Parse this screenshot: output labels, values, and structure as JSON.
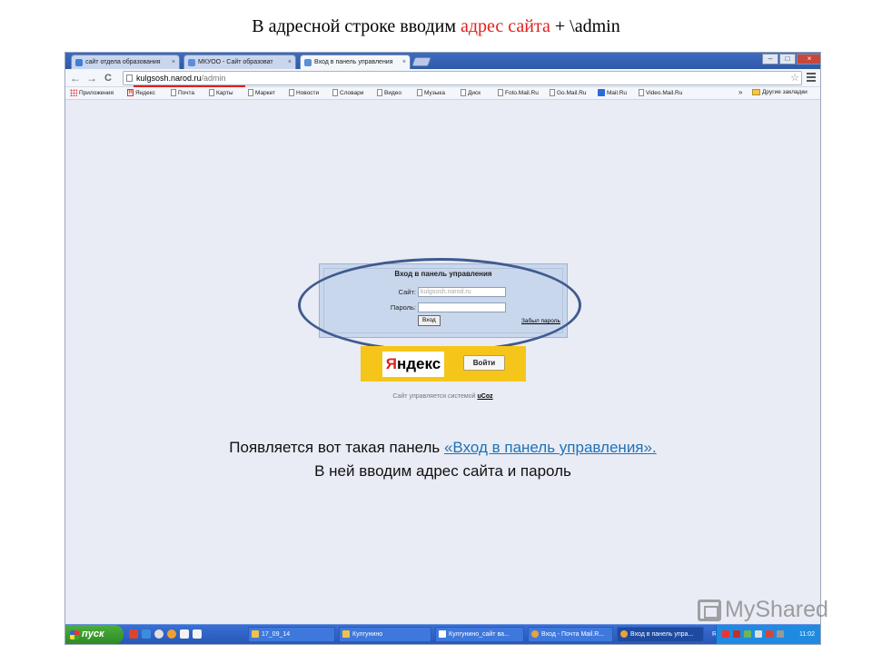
{
  "slide": {
    "title_prefix": "В адресной строке вводим ",
    "title_red": "адрес сайта",
    "title_suffix": " + \\admin"
  },
  "tabs": [
    {
      "label": "сайт отдела образования",
      "close": "×",
      "favicon_color": "#3d7fd9"
    },
    {
      "label": "МКУОО - Сайт образоват",
      "close": "×",
      "favicon_color": "#5b8fd6"
    },
    {
      "label": "Вход в панель управления",
      "close": "×",
      "favicon_color": "#5b8fd6"
    }
  ],
  "window_controls": {
    "minimize": "–",
    "maximize": "□",
    "close": "×"
  },
  "toolbar": {
    "back": "←",
    "forward": "→",
    "reload": "C",
    "url_host": "kulgsosh.narod.ru",
    "url_path": "/admin",
    "star": "☆"
  },
  "bookmarks": [
    {
      "label": "Приложения",
      "icon": "apps-icon"
    },
    {
      "label": "Яндекс",
      "icon": "yandex-icon"
    },
    {
      "label": "Почта",
      "icon": "page-icon"
    },
    {
      "label": "Карты",
      "icon": "page-icon"
    },
    {
      "label": "Маркет",
      "icon": "page-icon"
    },
    {
      "label": "Новости",
      "icon": "page-icon"
    },
    {
      "label": "Словари",
      "icon": "page-icon"
    },
    {
      "label": "Видео",
      "icon": "page-icon"
    },
    {
      "label": "Музыка",
      "icon": "page-icon"
    },
    {
      "label": "Диск",
      "icon": "page-icon"
    },
    {
      "label": "Foto.Mail.Ru",
      "icon": "page-icon"
    },
    {
      "label": "Go.Mail.Ru",
      "icon": "page-icon"
    },
    {
      "label": "Mail.Ru",
      "icon": "mail-icon"
    },
    {
      "label": "Video.Mail.Ru",
      "icon": "page-icon"
    }
  ],
  "bookmarks_more": "»",
  "other_bookmarks": "Другие закладки",
  "login": {
    "title": "Вход в панель управления",
    "site_label": "Сайт:",
    "site_value": "kulgsosh.narod.ru",
    "password_label": "Пароль:",
    "password_value": "",
    "submit": "Вход",
    "forgot": "Забыл пароль"
  },
  "yandex": {
    "logo_red": "Я",
    "logo_rest": "ндекс",
    "button": "Войти"
  },
  "managed": {
    "prefix": "Сайт управляется системой ",
    "system": "uCoz"
  },
  "caption": {
    "line1_prefix": "Появляется вот такая панель ",
    "line1_link": "«Вход в панель управления».",
    "line2": "В ней вводим адрес сайта и пароль"
  },
  "taskbar": {
    "start": "пуск",
    "tasks": [
      {
        "label": "17_09_14",
        "icon_color": "#f0c24a"
      },
      {
        "label": "Кулгунино",
        "icon_color": "#f0c24a"
      },
      {
        "label": "Кулгунино_сайт ва...",
        "icon_color": "#ffffff"
      },
      {
        "label": "Вход - Почта Mail.R...",
        "icon_color": "#e8a33a"
      },
      {
        "label": "Вход в панель упра...",
        "icon_color": "#e8a33a"
      }
    ],
    "lang": "RU",
    "time": "11:02"
  },
  "watermark": "MyShared"
}
